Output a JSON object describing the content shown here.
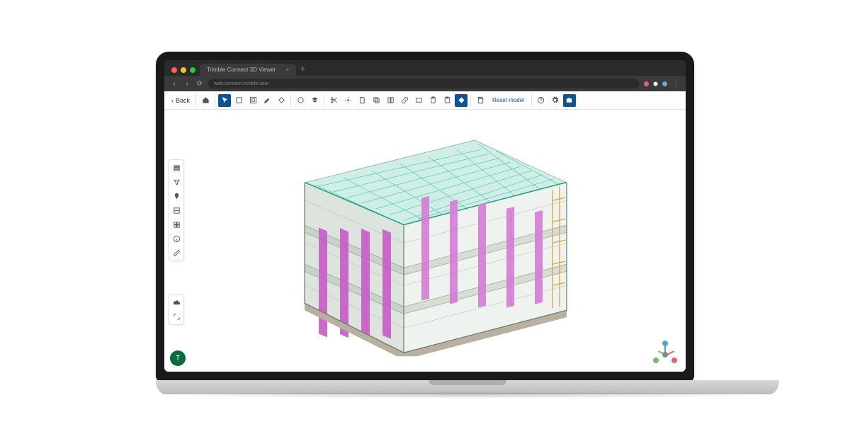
{
  "browser": {
    "tab_title": "Trimble Connect 3D Viewer",
    "url": "web.connect.trimble.com",
    "addr_indicator_colors": [
      "#e06666",
      "#ffffff",
      "#6fa8dc"
    ]
  },
  "toolbar": {
    "back_label": "Back",
    "reset_label": "Reset model",
    "icons": [
      "pointer",
      "hand",
      "fit",
      "select-box",
      "edit",
      "section",
      "circle",
      "layers",
      "scissors",
      "settings-alt",
      "document",
      "copy",
      "match",
      "link",
      "rect",
      "clipboard",
      "paste",
      "diamond"
    ],
    "right_icons": [
      "help",
      "gear",
      "briefcase"
    ]
  },
  "side_toolbar_1": [
    "layers-panel",
    "filter",
    "pin",
    "clip",
    "grid",
    "info",
    "measure"
  ],
  "side_toolbar_2": [
    "cloud",
    "expand"
  ],
  "viewport": {
    "badge_label": "T",
    "axes": [
      "x",
      "y",
      "z"
    ]
  },
  "model": {
    "description": "3D building cutaway",
    "accent_colors": {
      "columns": "#c85ec8",
      "mesh": "#35bfa5",
      "structure": "#8a9a8a",
      "floor": "#b8b0a0"
    }
  }
}
